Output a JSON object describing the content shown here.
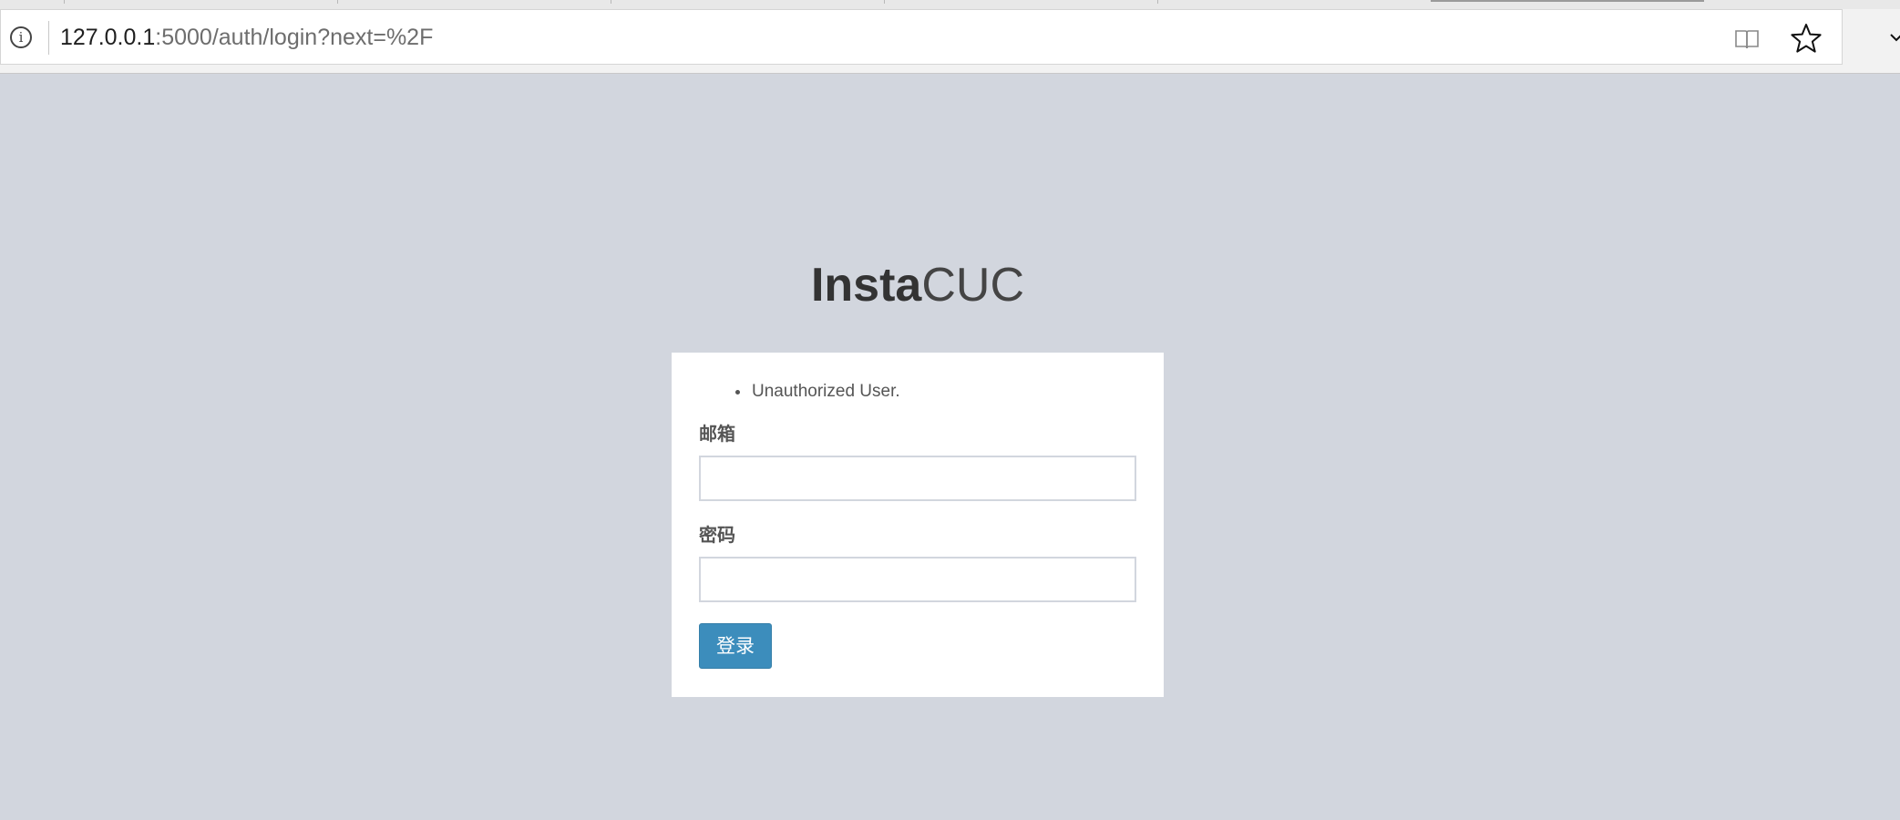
{
  "browser": {
    "url_host": "127.0.0.1",
    "url_rest": ":5000/auth/login?next=%2F",
    "icons": {
      "info": "info-icon",
      "reader": "reading-view-icon",
      "favorite": "star-icon",
      "menu": "chevron-down-icon"
    }
  },
  "page": {
    "brand_bold": "Insta",
    "brand_light": "CUC",
    "flash_messages": [
      "Unauthorized User."
    ],
    "email_label": "邮箱",
    "email_value": "",
    "password_label": "密码",
    "password_value": "",
    "submit_label": "登录",
    "colors": {
      "background": "#d2d6de",
      "button": "#3c8dbc"
    }
  }
}
